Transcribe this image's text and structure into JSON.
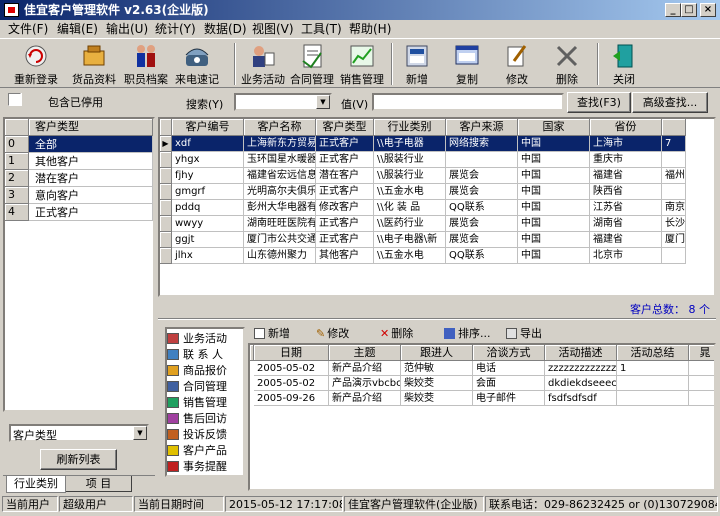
{
  "window": {
    "title": "佳宜客户管理软件 v2.63(企业版)",
    "min": "_",
    "max": "□",
    "close": "×"
  },
  "menu": [
    "文件(F)",
    "编辑(E)",
    "输出(U)",
    "统计(Y)",
    "数据(D)",
    "视图(V)",
    "工具(T)",
    "帮助(H)"
  ],
  "toolbar": [
    {
      "label": "重新登录",
      "icon": "relogin-icon"
    },
    {
      "label": "货品资料",
      "icon": "goods-icon"
    },
    {
      "label": "职员档案",
      "icon": "staff-icon"
    },
    {
      "label": "来电速记",
      "icon": "phone-icon"
    },
    {
      "label": "业务活动",
      "icon": "business-icon"
    },
    {
      "label": "合同管理",
      "icon": "contract-icon"
    },
    {
      "label": "销售管理",
      "icon": "sales-icon"
    },
    {
      "label": "新增",
      "icon": "add-icon"
    },
    {
      "label": "复制",
      "icon": "copy-icon"
    },
    {
      "label": "修改",
      "icon": "edit-icon"
    },
    {
      "label": "删除",
      "icon": "delete-icon"
    },
    {
      "label": "关闭",
      "icon": "close-icon"
    }
  ],
  "filter": {
    "include_disabled": "包含已停用",
    "search_label": "搜索(Y)",
    "search_value": "",
    "value_label": "值(V)",
    "value_text": "",
    "find_btn": "查找(F3)",
    "advanced_btn": "高级查找..."
  },
  "type_tree": {
    "header": "客户类型",
    "rows": [
      {
        "n": "0",
        "label": "全部"
      },
      {
        "n": "1",
        "label": "其他客户"
      },
      {
        "n": "2",
        "label": "潜在客户"
      },
      {
        "n": "3",
        "label": "意向客户"
      },
      {
        "n": "4",
        "label": "正式客户"
      }
    ]
  },
  "left_bottom": {
    "combo_value": "客户类型",
    "refresh_btn": "刷新列表",
    "tabs": [
      "行业类别",
      "项 目"
    ]
  },
  "customers": {
    "columns": [
      "客户编号",
      "客户名称",
      "客户类型",
      "行业类别",
      "客户来源",
      "国家",
      "省份",
      ""
    ],
    "rows": [
      [
        "xdf",
        "上海新东方贸易",
        "正式客户",
        "\\\\电子电器",
        "网络搜索",
        "中国",
        "上海市",
        "7"
      ],
      [
        "yhgx",
        "玉环国星水暖器",
        "正式客户",
        "\\\\服装行业",
        "",
        "中国",
        "重庆市",
        ""
      ],
      [
        "fjhy",
        "福建省宏远信息",
        "潜在客户",
        "\\\\服装行业",
        "展览会",
        "中国",
        "福建省",
        "福州"
      ],
      [
        "gmgrf",
        "光明高尔夫俱乐",
        "正式客户",
        "\\\\五金水电",
        "展览会",
        "中国",
        "陕西省",
        ""
      ],
      [
        "pddq",
        "彭州大华电器有",
        "修改客户",
        "\\\\化 装 品",
        "QQ联系",
        "中国",
        "江苏省",
        "南京"
      ],
      [
        "wwyy",
        "湖南旺旺医院有",
        "正式客户",
        "\\\\医药行业",
        "展览会",
        "中国",
        "湖南省",
        "长沙"
      ],
      [
        "ggjt",
        "厦门市公共交通",
        "正式客户",
        "\\\\电子电器\\新",
        "展览会",
        "中国",
        "福建省",
        "厦门"
      ],
      [
        "jlhx",
        "山东德州聚力",
        "其他客户",
        "\\\\五金水电",
        "QQ联系",
        "中国",
        "北京市",
        ""
      ]
    ],
    "total_label": "客户总数： 8 个"
  },
  "side_nav": [
    {
      "label": "业务活动",
      "icon": "activity-icon"
    },
    {
      "label": "联 系 人",
      "icon": "contact-icon"
    },
    {
      "label": "商品报价",
      "icon": "quote-icon"
    },
    {
      "label": "合同管理",
      "icon": "contract-nav-icon"
    },
    {
      "label": "销售管理",
      "icon": "sales-nav-icon"
    },
    {
      "label": "售后回访",
      "icon": "visit-icon"
    },
    {
      "label": "投诉反馈",
      "icon": "complaint-icon"
    },
    {
      "label": "客户产品",
      "icon": "product-icon"
    },
    {
      "label": "事务提醒",
      "icon": "reminder-icon"
    }
  ],
  "detail_toolbar": [
    "新增",
    "修改",
    "删除",
    "排序...",
    "导出"
  ],
  "activities": {
    "columns": [
      "日期",
      "主题",
      "跟进人",
      "洽谈方式",
      "活动描述",
      "活动总结",
      "晁"
    ],
    "rows": [
      [
        "2005-05-02",
        "新产品介绍",
        "范仲敏",
        "电话",
        "zzzzzzzzzzzzz",
        "1",
        ""
      ],
      [
        "2005-05-02",
        "产品演示vbcbc",
        "柴姣茭",
        "会面",
        "dkdiekdseeecc",
        "",
        ""
      ],
      [
        "2005-09-26",
        "新产品介绍",
        "柴姣茭",
        "电子邮件",
        "fsdfsdfsdf",
        "",
        ""
      ]
    ]
  },
  "status": [
    "当前用户",
    "超级用户",
    "当前日期时间",
    "2015-05-12 17:17:08",
    "佳宜客户管理软件(企业版)",
    "联系电话：029-86232425 or (0)13072908445"
  ],
  "colors": {
    "title_start": "#0a246a",
    "title_end": "#a6caf0",
    "selection": "#0a246a",
    "accent_blue": "#0000c0"
  }
}
